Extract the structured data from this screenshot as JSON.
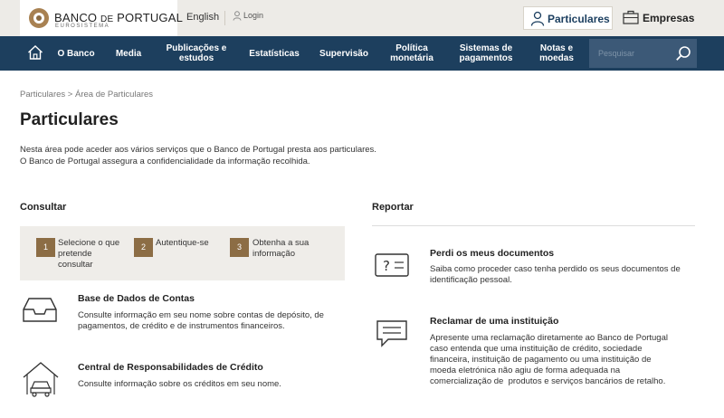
{
  "header": {
    "logo_name_big1": "BANCO ",
    "logo_name_small": "DE",
    "logo_name_big2": " PORTUGAL",
    "logo_sub": "EUROSISTEMA",
    "language": "English",
    "login": "Login",
    "tab_particulares": "Particulares",
    "tab_empresas": "Empresas"
  },
  "nav": {
    "items": [
      {
        "line1": "O Banco",
        "line2": ""
      },
      {
        "line1": "Media",
        "line2": ""
      },
      {
        "line1": "Publicações e",
        "line2": "estudos"
      },
      {
        "line1": "Estatísticas",
        "line2": ""
      },
      {
        "line1": "Supervisão",
        "line2": ""
      },
      {
        "line1": "Política",
        "line2": "monetária"
      },
      {
        "line1": "Sistemas de",
        "line2": "pagamentos"
      },
      {
        "line1": "Notas e",
        "line2": "moedas"
      }
    ],
    "search_placeholder": "Pesquisar"
  },
  "page": {
    "breadcrumb": "Particulares > Área de Particulares",
    "title": "Particulares",
    "intro_line1": "Nesta área pode aceder aos vários serviços que o Banco de Portugal presta aos particulares.",
    "intro_line2": "O Banco de Portugal assegura a confidencialidade da informação recolhida."
  },
  "consultar": {
    "heading": "Consultar",
    "steps": [
      {
        "num": "1",
        "line1": "Selecione o que",
        "line2": "pretende",
        "line3": "consultar"
      },
      {
        "num": "2",
        "line1": "Autentique-se",
        "line2": "",
        "line3": ""
      },
      {
        "num": "3",
        "line1": "Obtenha a sua",
        "line2": "informação",
        "line3": ""
      }
    ],
    "cards": [
      {
        "title": "Base de Dados de Contas",
        "line1": "Consulte informação em seu nome sobre contas de depósito, de",
        "line2": "pagamentos, de crédito e de instrumentos financeiros."
      },
      {
        "title": "Central de Responsabilidades de Crédito",
        "line1": "Consulte informação sobre os créditos em seu nome.",
        "line2": ""
      }
    ]
  },
  "reportar": {
    "heading": "Reportar",
    "cards": [
      {
        "title": "Perdi os meus documentos",
        "lines": [
          "Saiba como proceder caso tenha perdido os seus documentos de",
          "identificação pessoal."
        ]
      },
      {
        "title": "Reclamar de uma instituição",
        "lines": [
          "Apresente uma reclamação diretamente ao Banco de Portugal",
          "caso entenda que uma instituição de crédito, sociedade",
          "financeira, instituição de pagamento ou uma instituição de",
          "moeda eletrónica não agiu de forma adequada na",
          "comercialização de  produtos e serviços bancários de retalho."
        ]
      }
    ]
  },
  "colors": {
    "navy": "#1d3f5e",
    "gold": "#8c6d45",
    "beige": "#efede9"
  }
}
